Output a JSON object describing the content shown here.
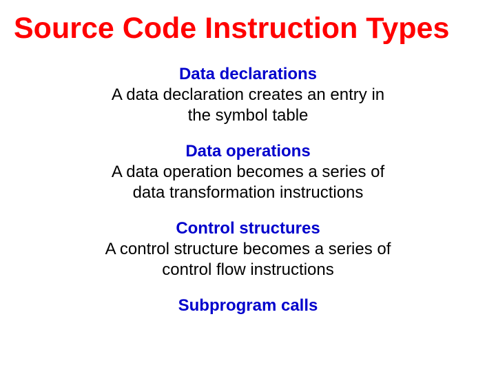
{
  "title": "Source Code Instruction Types",
  "sections": {
    "s1": {
      "heading": "Data declarations",
      "body1": "A data declaration creates an entry in",
      "body2": "the symbol table"
    },
    "s2": {
      "heading": "Data operations",
      "body1": "A data operation becomes a series of",
      "body2": "data transformation instructions"
    },
    "s3": {
      "heading": "Control structures",
      "body1": "A control structure becomes a series of",
      "body2": "control flow instructions"
    },
    "s4": {
      "heading": "Subprogram calls"
    }
  }
}
